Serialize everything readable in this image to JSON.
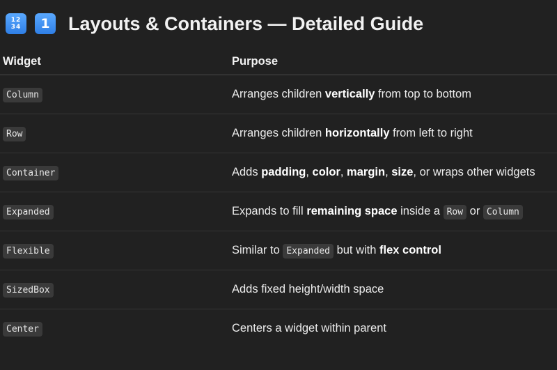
{
  "header": {
    "emoji_numbers_digits": "1234",
    "emoji_one_digit": "1",
    "title": "Layouts & Containers — Detailed Guide"
  },
  "table": {
    "columns": [
      "Widget",
      "Purpose"
    ],
    "rows": [
      {
        "widget": "Column",
        "purpose": [
          {
            "t": "Arranges children "
          },
          {
            "t": "vertically",
            "b": true
          },
          {
            "t": " from top to bottom"
          }
        ]
      },
      {
        "widget": "Row",
        "purpose": [
          {
            "t": "Arranges children "
          },
          {
            "t": "horizontally",
            "b": true
          },
          {
            "t": " from left to right"
          }
        ]
      },
      {
        "widget": "Container",
        "purpose": [
          {
            "t": "Adds "
          },
          {
            "t": "padding",
            "b": true
          },
          {
            "t": ", "
          },
          {
            "t": "color",
            "b": true
          },
          {
            "t": ", "
          },
          {
            "t": "margin",
            "b": true
          },
          {
            "t": ", "
          },
          {
            "t": "size",
            "b": true
          },
          {
            "t": ", or wraps other widgets"
          }
        ]
      },
      {
        "widget": "Expanded",
        "purpose": [
          {
            "t": "Expands to fill "
          },
          {
            "t": "remaining space",
            "b": true
          },
          {
            "t": " inside a "
          },
          {
            "t": "Row",
            "c": true
          },
          {
            "t": " or "
          },
          {
            "t": "Column",
            "c": true
          }
        ]
      },
      {
        "widget": "Flexible",
        "purpose": [
          {
            "t": "Similar to "
          },
          {
            "t": "Expanded",
            "c": true
          },
          {
            "t": " but with "
          },
          {
            "t": "flex control",
            "b": true
          }
        ]
      },
      {
        "widget": "SizedBox",
        "purpose": [
          {
            "t": "Adds fixed height/width space"
          }
        ]
      },
      {
        "widget": "Center",
        "purpose": [
          {
            "t": "Centers a widget within parent"
          }
        ]
      }
    ]
  }
}
